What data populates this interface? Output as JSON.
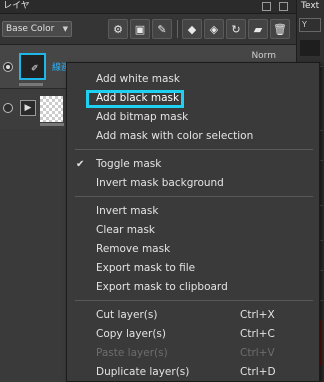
{
  "panel": {
    "title": "レイヤ",
    "right_panel_title": "Text",
    "right_panel_label": "Y"
  },
  "toolbar": {
    "blend_mode": "Base Color"
  },
  "layers": [
    {
      "name": "線画ｵﾄﾞﾚｲﾔ",
      "blend": "Norm",
      "visible": true
    },
    {
      "name": "",
      "visible": false
    }
  ],
  "menu": {
    "groups": [
      [
        {
          "label": "Add white mask"
        },
        {
          "label": "Add black mask",
          "highlighted": true
        },
        {
          "label": "Add bitmap mask"
        },
        {
          "label": "Add mask with color selection"
        }
      ],
      [
        {
          "label": "Toggle mask",
          "checked": true
        },
        {
          "label": "Invert mask background"
        }
      ],
      [
        {
          "label": "Invert mask"
        },
        {
          "label": "Clear mask"
        },
        {
          "label": "Remove mask"
        },
        {
          "label": "Export mask to file"
        },
        {
          "label": "Export mask to clipboard"
        }
      ],
      [
        {
          "label": "Cut layer(s)",
          "shortcut": "Ctrl+X"
        },
        {
          "label": "Copy layer(s)",
          "shortcut": "Ctrl+C"
        },
        {
          "label": "Paste layer(s)",
          "shortcut": "Ctrl+V",
          "disabled": true
        },
        {
          "label": "Duplicate layer(s)",
          "shortcut": "Ctrl+D"
        }
      ]
    ]
  },
  "colors": {
    "selection_border": "#1fb6e8",
    "highlight_box": "#1fd1f0",
    "layer_name": "#29b4ff"
  }
}
